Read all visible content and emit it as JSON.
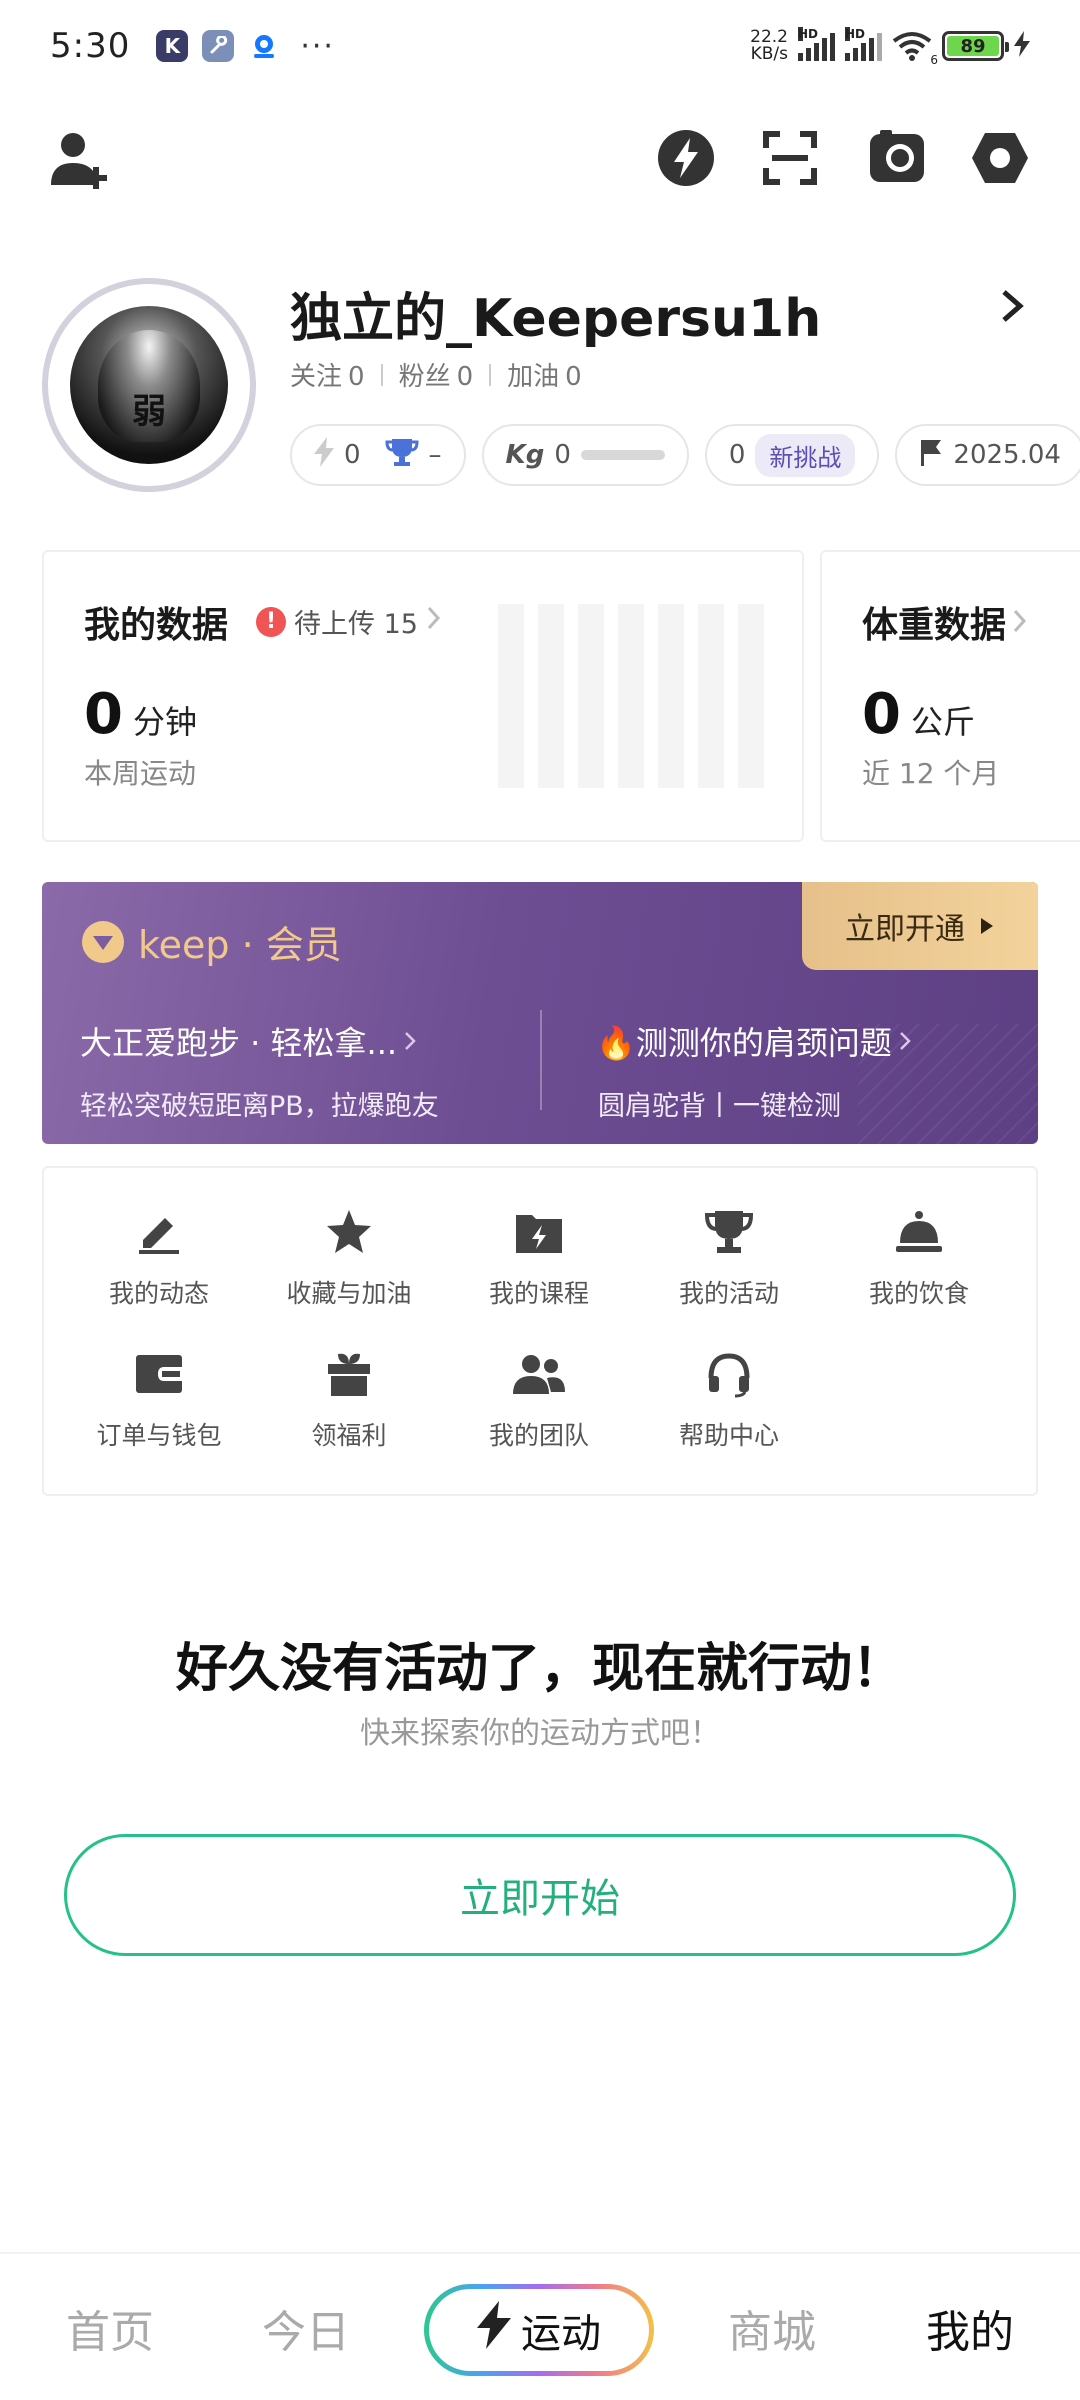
{
  "status_bar": {
    "time": "5:30",
    "net_speed_value": "22.2",
    "net_speed_unit": "KB/s",
    "hd1": "HD",
    "hd2": "HD",
    "wifi_badge": "6",
    "battery": "89",
    "more": "···"
  },
  "top_bar": {
    "icons": [
      "add-friend-icon",
      "lightning-icon",
      "scan-icon",
      "camera-icon",
      "settings-icon"
    ]
  },
  "profile": {
    "username": "独立的_Keepersu1h",
    "avatar_text": "弱",
    "follow_label": "关注",
    "follow_count": "0",
    "fans_label": "粉丝",
    "fans_count": "0",
    "cheer_label": "加油",
    "cheer_count": "0",
    "chips": {
      "energy_value": "0",
      "trophy_value": "–",
      "kg_value": "0",
      "challenge_value": "0",
      "challenge_tag": "新挑战",
      "date_value": "2025.04"
    }
  },
  "my_data": {
    "title": "我的数据",
    "pending_label": "待上传 15",
    "value": "0",
    "unit": "分钟",
    "sub": "本周运动"
  },
  "weight_data": {
    "title": "体重数据",
    "value": "0",
    "unit": "公斤",
    "sub": "近 12 个月"
  },
  "vip": {
    "logo_text": "keep · 会员",
    "open_label": "立即开通",
    "left_title": "大正爱跑步 · 轻松拿...",
    "left_sub": "轻松突破短距离PB，拉爆跑友",
    "right_title": "🔥测测你的肩颈问题",
    "right_sub": "圆肩驼背丨一键检测"
  },
  "menu": [
    {
      "label": "我的动态",
      "icon": "edit-icon"
    },
    {
      "label": "收藏与加油",
      "icon": "star-icon"
    },
    {
      "label": "我的课程",
      "icon": "course-folder-icon"
    },
    {
      "label": "我的活动",
      "icon": "trophy-icon"
    },
    {
      "label": "我的饮食",
      "icon": "food-cloche-icon"
    },
    {
      "label": "订单与钱包",
      "icon": "wallet-icon"
    },
    {
      "label": "领福利",
      "icon": "gift-icon"
    },
    {
      "label": "我的团队",
      "icon": "team-icon"
    },
    {
      "label": "帮助中心",
      "icon": "headset-icon"
    }
  ],
  "empty_state": {
    "title": "好久没有活动了，现在就行动！",
    "subtitle": "快来探索你的运动方式吧！",
    "button": "立即开始"
  },
  "bottom_nav": {
    "home": "首页",
    "today": "今日",
    "sport": "运动",
    "mall": "商城",
    "mine": "我的",
    "active": "mine"
  },
  "colors": {
    "accent_green": "#24c28a",
    "vip_purple": "#6e4e93",
    "vip_gold": "#f1c98b",
    "warn_red": "#f05454"
  }
}
